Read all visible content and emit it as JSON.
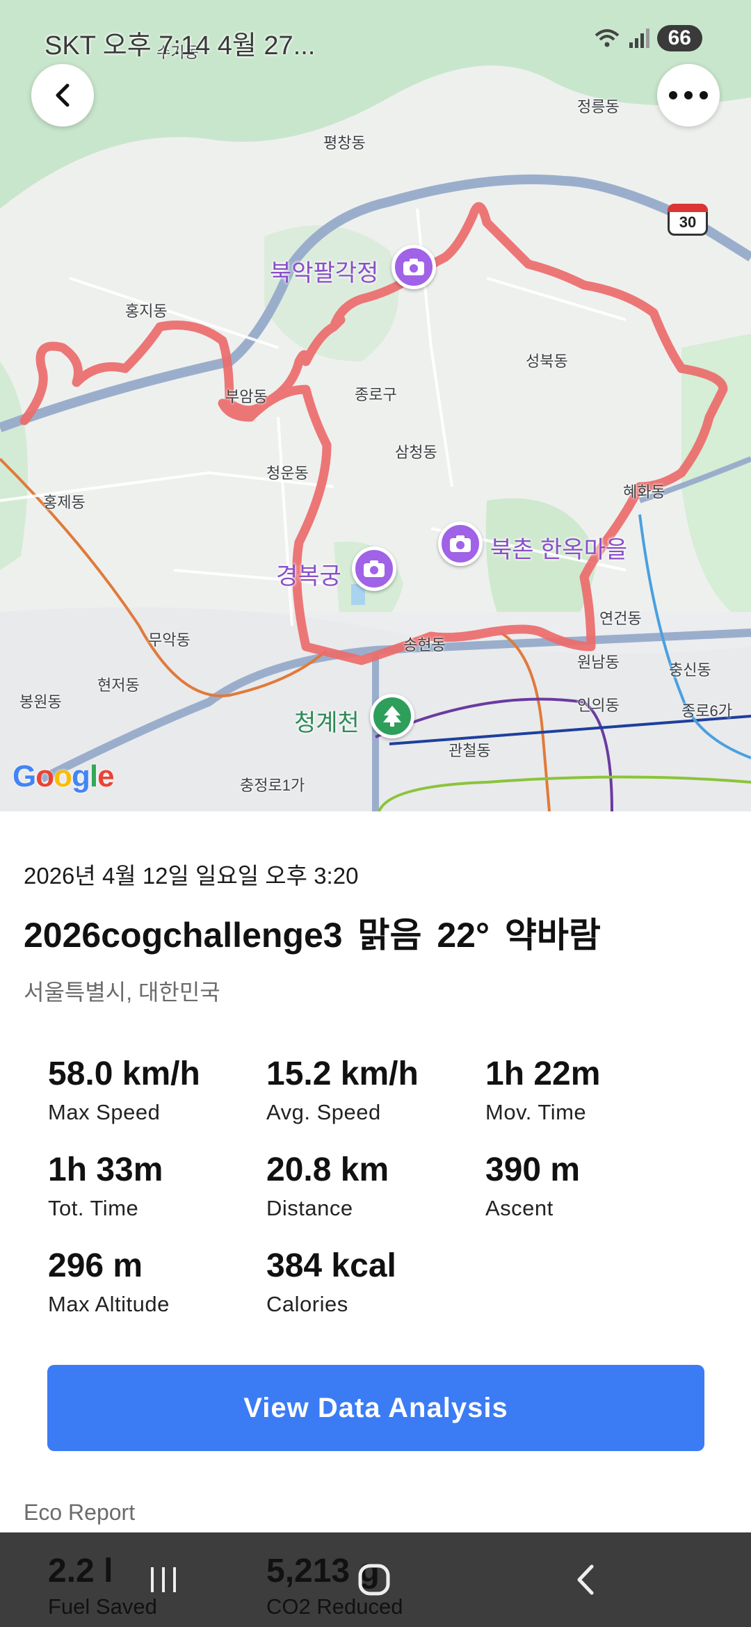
{
  "status_bar": {
    "left_text": "SKT 오후 7:14  4월 27...",
    "battery": "66"
  },
  "map": {
    "labels": {
      "neighborhood_1": "수기동",
      "neighborhood_2": "정릉동",
      "neighborhood_3": "평창동",
      "neighborhood_4": "홍지동",
      "neighborhood_5": "성북동",
      "neighborhood_6": "부암동",
      "neighborhood_7": "종로구",
      "neighborhood_8": "삼청동",
      "neighborhood_9": "청운동",
      "neighborhood_10": "혜화동",
      "neighborhood_11": "홍제동",
      "neighborhood_12": "연건동",
      "neighborhood_13": "무악동",
      "neighborhood_14": "송현동",
      "neighborhood_15": "원남동",
      "neighborhood_16": "충신동",
      "neighborhood_17": "현저동",
      "neighborhood_18": "봉원동",
      "neighborhood_19": "인의동",
      "neighborhood_20": "종로6가",
      "neighborhood_21": "관철동",
      "neighborhood_22": "충정로1가"
    },
    "pois": {
      "bugak": "북악팔각정",
      "bukchon": "북촌 한옥마을",
      "gyeongbok": "경복궁",
      "cheonggye": "청계천"
    },
    "road_number": "30",
    "google_logo": {
      "g1": "G",
      "o1": "o",
      "o2": "o",
      "g2": "g",
      "l": "l",
      "e": "e"
    }
  },
  "ride": {
    "date": "2026년 4월 12일 일요일 오후 3:20",
    "title": "2026cogchallenge3  맑음  22°  약바람",
    "location": "서울특별시, 대한민국"
  },
  "stats": [
    {
      "value": "58.0 km/h",
      "label": "Max Speed"
    },
    {
      "value": "15.2 km/h",
      "label": "Avg. Speed"
    },
    {
      "value": "1h 22m",
      "label": "Mov. Time"
    },
    {
      "value": "1h 33m",
      "label": "Tot. Time"
    },
    {
      "value": "20.8 km",
      "label": "Distance"
    },
    {
      "value": "390 m",
      "label": "Ascent"
    },
    {
      "value": "296 m",
      "label": "Max Altitude"
    },
    {
      "value": "384 kcal",
      "label": "Calories"
    }
  ],
  "analysis_button": "View Data Analysis",
  "eco_report": {
    "title": "Eco Report",
    "items": [
      {
        "value": "2.2 l",
        "label": "Fuel Saved"
      },
      {
        "value": "5,213 g",
        "label": "CO2 Reduced"
      }
    ]
  },
  "colors": {
    "accent": "#3b7cf5",
    "route": "#ec6b6b",
    "poi": "#a062e6",
    "park": "#2e9e5b"
  },
  "icons": {
    "back": "chevron-left-icon",
    "more": "more-horizontal-icon",
    "camera": "camera-pin-icon",
    "tree": "tree-pin-icon",
    "nav_recents": "recents-icon",
    "nav_home": "home-icon",
    "nav_back": "back-icon"
  }
}
